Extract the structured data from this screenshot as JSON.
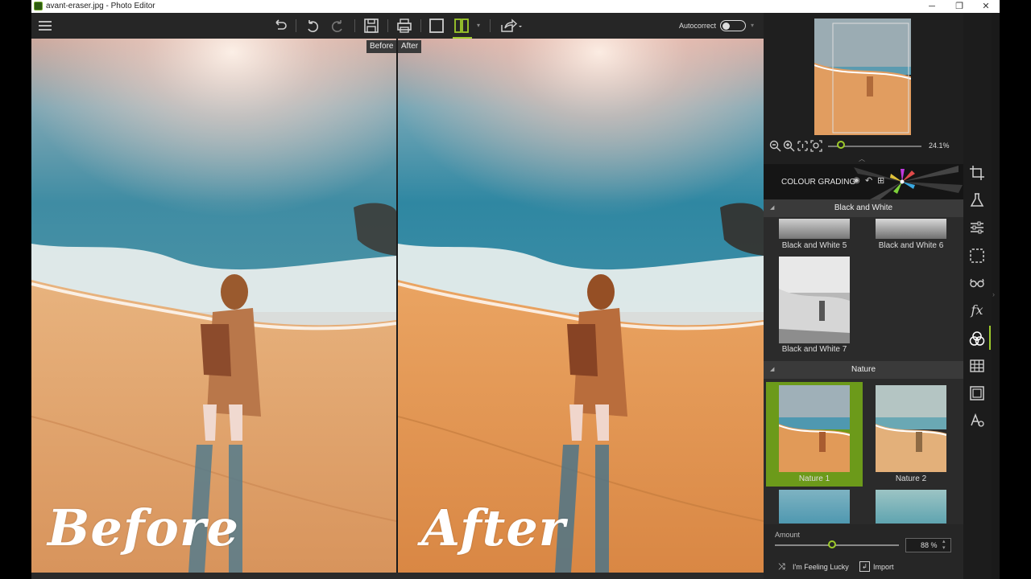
{
  "window": {
    "title": "avant-eraser.jpg - Photo Editor",
    "minimize": "─",
    "maximize": "❐",
    "close": "✕"
  },
  "toolbar": {
    "menu_icon": "hamburger-icon",
    "before_label": "Before",
    "after_label": "After",
    "autocorrect_label": "Autocorrect",
    "autocorrect_on": false
  },
  "canvas": {
    "before_caption": "Before",
    "after_caption": "After"
  },
  "navigator": {
    "zoom_value": "24.1%",
    "zoom_fraction": 0.14
  },
  "colour_grading": {
    "title": "COLOUR GRADING"
  },
  "sections": {
    "bw": {
      "title": "Black and White",
      "items": [
        "Black and White 5",
        "Black and White 6",
        "Black and White 7"
      ]
    },
    "nature": {
      "title": "Nature",
      "items": [
        "Nature 1",
        "Nature 2"
      ],
      "selected": "Nature 1"
    }
  },
  "amount": {
    "label": "Amount",
    "value": "88 %",
    "fraction": 0.46
  },
  "actions": {
    "lucky": "I'm Feeling Lucky",
    "import": "Import"
  },
  "colors": {
    "accent": "#9ecb2b",
    "selected": "#6c9a1a",
    "panel": "#2b2b2b",
    "sand": "#e0a36a",
    "sea": "#3f8fa6"
  }
}
